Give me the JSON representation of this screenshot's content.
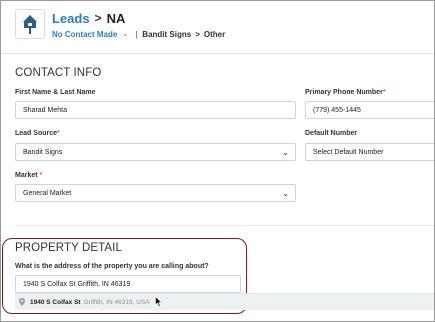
{
  "header": {
    "breadcrumb_link": "Leads",
    "breadcrumb_separator": ">",
    "breadcrumb_current": "NA",
    "status": "No Contact Made",
    "source": "Bandit Signs",
    "source_arrow": ">",
    "category": "Other"
  },
  "contact": {
    "section_title": "CONTACT INFO",
    "name_label": "First Name & Last Name",
    "name_value": "Sharad Mehta",
    "phone_label": "Primary Phone Number",
    "phone_value": "(779) 455-1445",
    "lead_source_label": "Lead Source",
    "lead_source_value": "Bandit Signs",
    "default_number_label": "Default Number",
    "default_number_value": "Select Default Number",
    "market_label": "Market",
    "market_value": "General Market"
  },
  "property": {
    "section_title": "PROPERTY DETAIL",
    "question": "What is the address of the property you are calling about?",
    "address_value": "1940 S Colfax St Griffith, IN 46319",
    "suggestion_main": "1940 S Colfax St",
    "suggestion_secondary": "Griffith, IN 46319, USA"
  },
  "required_marker": "*",
  "colors": {
    "accent": "#2a7fb8",
    "highlight_border": "#8b1a1a",
    "required": "#d9534f"
  },
  "icons": {
    "logo": "house-sign-icon",
    "select_arrow": "chevron-down-icon",
    "suggestion_pin": "map-pin-icon",
    "pointer": "mouse-cursor-icon"
  }
}
